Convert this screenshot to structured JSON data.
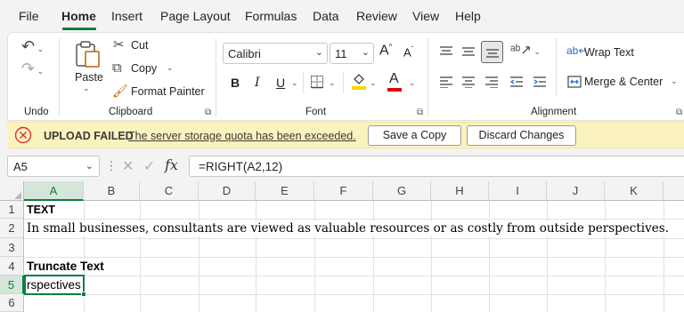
{
  "menu": {
    "items": [
      "File",
      "Home",
      "Insert",
      "Page Layout",
      "Formulas",
      "Data",
      "Review",
      "View",
      "Help"
    ],
    "active": "Home"
  },
  "ribbon": {
    "undo": {
      "group_label": "Undo"
    },
    "clipboard": {
      "paste_label": "Paste",
      "cut_label": "Cut",
      "copy_label": "Copy",
      "format_painter_label": "Format Painter",
      "group_label": "Clipboard"
    },
    "font": {
      "font_name": "Calibri",
      "font_size": "11",
      "grow_label": "A",
      "shrink_label": "A",
      "bold_label": "B",
      "italic_label": "I",
      "underline_label": "U",
      "font_color_label": "A",
      "group_label": "Font",
      "fill_color": "#ffd400",
      "font_color": "#e00000"
    },
    "alignment": {
      "wrap_text_label": "Wrap Text",
      "merge_center_label": "Merge & Center",
      "group_label": "Alignment"
    }
  },
  "banner": {
    "title": "UPLOAD FAILED",
    "message": "The server storage quota has been exceeded.",
    "save_copy_label": "Save a Copy",
    "discard_label": "Discard Changes"
  },
  "formula_bar": {
    "name_box": "A5",
    "fx_label": "fx",
    "formula": "=RIGHT(A2,12)"
  },
  "grid": {
    "columns": [
      "A",
      "B",
      "C",
      "D",
      "E",
      "F",
      "G",
      "H",
      "I",
      "J",
      "K"
    ],
    "rows": [
      "1",
      "2",
      "3",
      "4",
      "5",
      "6"
    ],
    "selected_column": "A",
    "selected_row": "5",
    "cells": {
      "A1": "TEXT",
      "A2": "In small businesses, consultants are viewed as valuable resources or as costly from outside perspectives.",
      "A4": "Truncate Text",
      "A5": "rspectives"
    }
  },
  "colors": {
    "accent": "#107c41",
    "banner_bg": "#fbf3bd",
    "error_red": "#d13438"
  }
}
